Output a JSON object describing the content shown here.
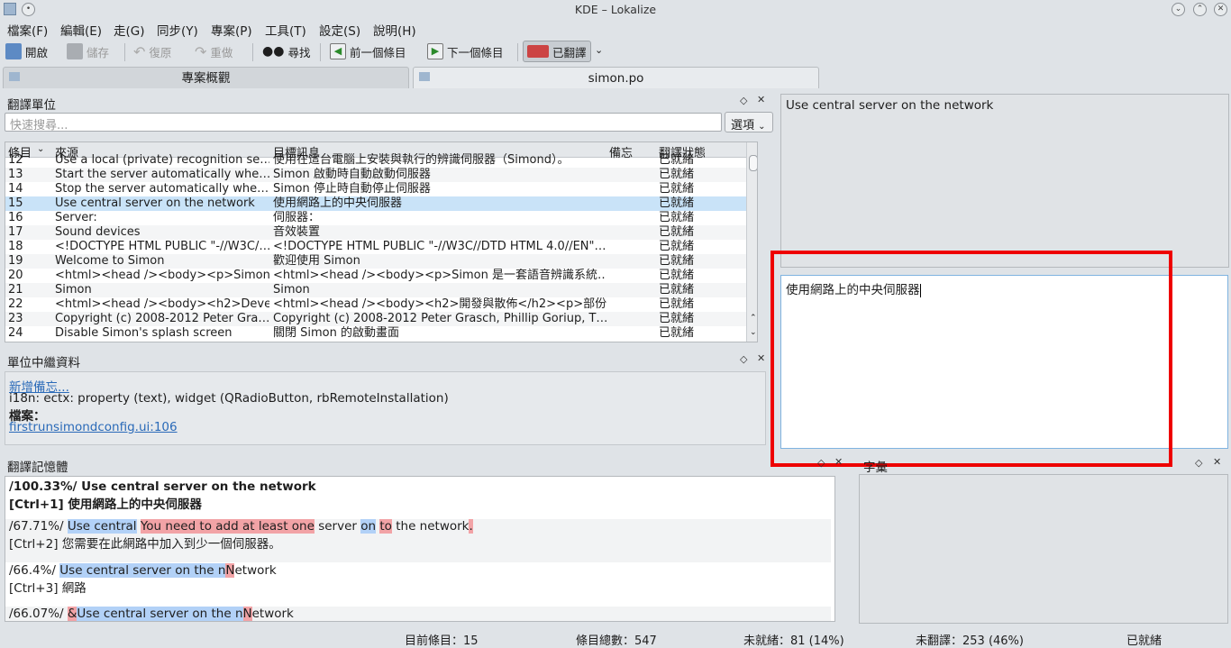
{
  "window": {
    "title": "KDE – Lokalize"
  },
  "menu": [
    "檔案(F)",
    "編輯(E)",
    "走(G)",
    "同步(Y)",
    "專案(P)",
    "工具(T)",
    "設定(S)",
    "說明(H)"
  ],
  "toolbar": {
    "open": "開啟",
    "save": "儲存",
    "undo": "復原",
    "redo": "重做",
    "find": "尋找",
    "prev": "前一個條目",
    "next": "下一個條目",
    "approved": "已翻譯"
  },
  "tabs": {
    "overview": "專案概觀",
    "file": "simon.po"
  },
  "units_panel": {
    "title": "翻譯單位",
    "search_placeholder": "快速搜尋...",
    "options": "選項",
    "headers": {
      "entry": "條目",
      "source": "來源",
      "target": "目標訊息",
      "notes": "備忘",
      "status": "翻譯狀態"
    },
    "rows": [
      {
        "n": "12",
        "src": "Use a local (private) recognition se…",
        "tgt": "使用在這台電腦上安裝與執行的辨識伺服器（Simond）。",
        "st": "已就緒"
      },
      {
        "n": "13",
        "src": "Start the server automatically whe…",
        "tgt": "Simon 啟動時自動啟動伺服器",
        "st": "已就緒"
      },
      {
        "n": "14",
        "src": "Stop the server automatically whe…",
        "tgt": "Simon 停止時自動停止伺服器",
        "st": "已就緒"
      },
      {
        "n": "15",
        "src": "Use central server on the network",
        "tgt": "使用網路上的中央伺服器",
        "st": "已就緒"
      },
      {
        "n": "16",
        "src": "Server:",
        "tgt": "伺服器：",
        "st": "已就緒"
      },
      {
        "n": "17",
        "src": "Sound devices",
        "tgt": "音效裝置",
        "st": "已就緒"
      },
      {
        "n": "18",
        "src": "<!DOCTYPE HTML PUBLIC \"-//W3C/…",
        "tgt": "<!DOCTYPE HTML PUBLIC \"-//W3C//DTD HTML 4.0//EN\"…",
        "st": "已就緒"
      },
      {
        "n": "19",
        "src": "Welcome to Simon",
        "tgt": "歡迎使用 Simon",
        "st": "已就緒"
      },
      {
        "n": "20",
        "src": "<html><head /><body><p>Simon i…",
        "tgt": "<html><head /><body><p>Simon 是一套語音辨識系統…",
        "st": "已就緒"
      },
      {
        "n": "21",
        "src": "Simon",
        "tgt": "Simon",
        "st": "已就緒"
      },
      {
        "n": "22",
        "src": "<html><head /><body><h2>Devel…",
        "tgt": "<html><head /><body><h2>開發與散佈</h2><p>部份…",
        "st": "已就緒"
      },
      {
        "n": "23",
        "src": "Copyright (c) 2008-2012 Peter Gra…",
        "tgt": "Copyright (c) 2008-2012 Peter Grasch, Phillip Goriup, T…",
        "st": "已就緒"
      },
      {
        "n": "24",
        "src": "Disable Simon's splash screen",
        "tgt": "關閉 Simon 的啟動畫面",
        "st": "已就緒"
      }
    ]
  },
  "metadata_panel": {
    "title": "單位中繼資料",
    "add_note": "新增備忘...",
    "context": "i18n: ectx: property (text), widget (QRadioButton, rbRemoteInstallation)",
    "files_label": "檔案：",
    "file_link": "firstrunsimondconfig.ui:106"
  },
  "source_text": "Use central server on the network",
  "target_text": "使用網路上的中央伺服器",
  "tm_panel": {
    "title": "翻譯記憶體",
    "m1": {
      "pct": "/100.33%/ Use central server on the network",
      "tr": "[Ctrl+1] 使用網路上的中央伺服器"
    },
    "m2": {
      "pct": "/67.71%/ ",
      "a": "Use central",
      "b": "You need to add at least one",
      "c": " server ",
      "d": "on",
      "e": " ",
      "f": "to",
      "g": " the network",
      "h": ".",
      "tr": "[Ctrl+2] 您需要在此網路中加入到少一個伺服器。"
    },
    "m3": {
      "pct": "/66.4%/ ",
      "a": "Use central server on the n",
      "b": "N",
      "c": "etwork",
      "tr": "[Ctrl+3] 網路"
    },
    "m4": {
      "pct": "/66.07%/ ",
      "a": "&",
      "b": "Use central server on the n",
      "c": "N",
      "d": "etwork"
    }
  },
  "glossary_panel": {
    "title": "字彙"
  },
  "status": {
    "current": "目前條目：15",
    "total": "條目總數：547",
    "fuzzy": "未就緒：81 (14%)",
    "untranslated": "未翻譯：253 (46%)",
    "state": "已就緒"
  }
}
